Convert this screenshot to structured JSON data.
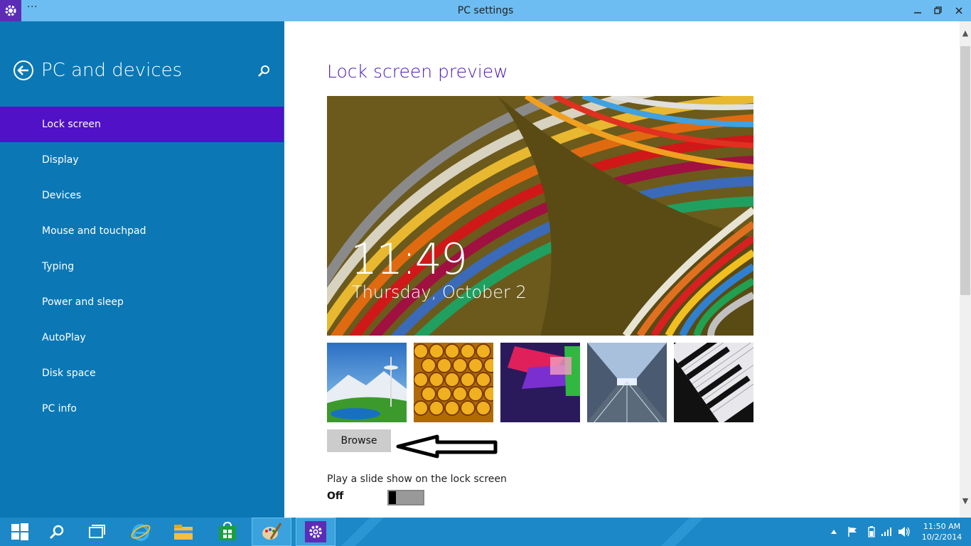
{
  "window": {
    "title": "PC settings",
    "menu_label": "···"
  },
  "sidebar": {
    "title": "PC and devices",
    "items": [
      {
        "label": "Lock screen",
        "active": true
      },
      {
        "label": "Display"
      },
      {
        "label": "Devices"
      },
      {
        "label": "Mouse and touchpad"
      },
      {
        "label": "Typing"
      },
      {
        "label": "Power and sleep"
      },
      {
        "label": "AutoPlay"
      },
      {
        "label": "Disk space"
      },
      {
        "label": "PC info"
      }
    ]
  },
  "main": {
    "section_title": "Lock screen preview",
    "preview": {
      "time": "11:49",
      "date": "Thursday, October 2"
    },
    "thumbnails": [
      "space-needle-image",
      "honeycomb-image",
      "geometric-logo-image",
      "train-tunnel-image",
      "piano-keys-image"
    ],
    "browse_label": "Browse",
    "slideshow": {
      "label": "Play a slide show on the lock screen",
      "state_label": "Off",
      "on": false
    }
  },
  "taskbar": {
    "apps": [
      "start-icon",
      "search-icon",
      "task-view-icon",
      "internet-explorer-icon",
      "file-explorer-icon",
      "store-icon",
      "paint-icon",
      "settings-icon"
    ],
    "clock": {
      "time": "11:50 AM",
      "date": "10/2/2014"
    }
  },
  "colors": {
    "sidebar_bg": "#0b78b5",
    "sidebar_active": "#5011c7",
    "title_bar": "#6dbdf2",
    "accent_title": "#4a1ab8",
    "taskbar_bg": "#1c88c7"
  }
}
